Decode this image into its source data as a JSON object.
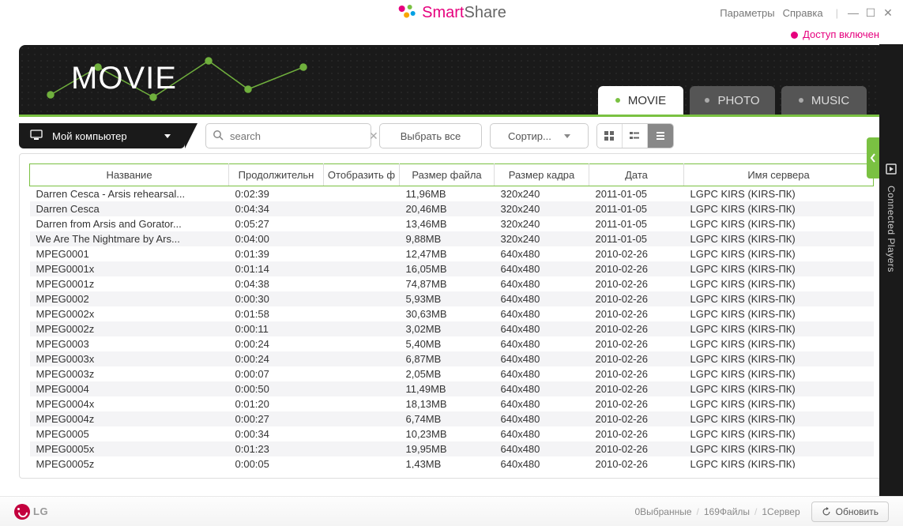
{
  "brand": {
    "smart": "Smart",
    "share": "Share"
  },
  "topmenu": {
    "params": "Параметры",
    "help": "Справка"
  },
  "access": {
    "label": "Доступ включен"
  },
  "header": {
    "title": "MOVIE"
  },
  "tabs": {
    "movie": "MOVIE",
    "photo": "PHOTO",
    "music": "MUSIC"
  },
  "source": {
    "label": "Мой компьютер"
  },
  "search": {
    "placeholder": "search"
  },
  "toolbar": {
    "select_all": "Выбрать все",
    "sort": "Сортир..."
  },
  "columns": {
    "name": "Название",
    "duration": "Продолжительн",
    "display": "Отобразить ф",
    "filesize": "Размер файла",
    "framesize": "Размер кадра",
    "date": "Дата",
    "server": "Имя сервера"
  },
  "rows": [
    {
      "name": "Darren Cesca - Arsis rehearsal...",
      "duration": "0:02:39",
      "display": "",
      "filesize": "11,96MB",
      "framesize": "320x240",
      "date": "2011-01-05",
      "server": "LGPC KIRS (KIRS-ПК)"
    },
    {
      "name": "Darren Cesca",
      "duration": "0:04:34",
      "display": "",
      "filesize": "20,46MB",
      "framesize": "320x240",
      "date": "2011-01-05",
      "server": "LGPC KIRS (KIRS-ПК)"
    },
    {
      "name": "Darren from Arsis and Gorator...",
      "duration": "0:05:27",
      "display": "",
      "filesize": "13,46MB",
      "framesize": "320x240",
      "date": "2011-01-05",
      "server": "LGPC KIRS (KIRS-ПК)"
    },
    {
      "name": "We Are The Nightmare by Ars...",
      "duration": "0:04:00",
      "display": "",
      "filesize": "9,88MB",
      "framesize": "320x240",
      "date": "2011-01-05",
      "server": "LGPC KIRS (KIRS-ПК)"
    },
    {
      "name": "MPEG0001",
      "duration": "0:01:39",
      "display": "",
      "filesize": "12,47MB",
      "framesize": "640x480",
      "date": "2010-02-26",
      "server": "LGPC KIRS (KIRS-ПК)"
    },
    {
      "name": "MPEG0001x",
      "duration": "0:01:14",
      "display": "",
      "filesize": "16,05MB",
      "framesize": "640x480",
      "date": "2010-02-26",
      "server": "LGPC KIRS (KIRS-ПК)"
    },
    {
      "name": "MPEG0001z",
      "duration": "0:04:38",
      "display": "",
      "filesize": "74,87MB",
      "framesize": "640x480",
      "date": "2010-02-26",
      "server": "LGPC KIRS (KIRS-ПК)"
    },
    {
      "name": "MPEG0002",
      "duration": "0:00:30",
      "display": "",
      "filesize": "5,93MB",
      "framesize": "640x480",
      "date": "2010-02-26",
      "server": "LGPC KIRS (KIRS-ПК)"
    },
    {
      "name": "MPEG0002x",
      "duration": "0:01:58",
      "display": "",
      "filesize": "30,63MB",
      "framesize": "640x480",
      "date": "2010-02-26",
      "server": "LGPC KIRS (KIRS-ПК)"
    },
    {
      "name": "MPEG0002z",
      "duration": "0:00:11",
      "display": "",
      "filesize": "3,02MB",
      "framesize": "640x480",
      "date": "2010-02-26",
      "server": "LGPC KIRS (KIRS-ПК)"
    },
    {
      "name": "MPEG0003",
      "duration": "0:00:24",
      "display": "",
      "filesize": "5,40MB",
      "framesize": "640x480",
      "date": "2010-02-26",
      "server": "LGPC KIRS (KIRS-ПК)"
    },
    {
      "name": "MPEG0003x",
      "duration": "0:00:24",
      "display": "",
      "filesize": "6,87MB",
      "framesize": "640x480",
      "date": "2010-02-26",
      "server": "LGPC KIRS (KIRS-ПК)"
    },
    {
      "name": "MPEG0003z",
      "duration": "0:00:07",
      "display": "",
      "filesize": "2,05MB",
      "framesize": "640x480",
      "date": "2010-02-26",
      "server": "LGPC KIRS (KIRS-ПК)"
    },
    {
      "name": "MPEG0004",
      "duration": "0:00:50",
      "display": "",
      "filesize": "11,49MB",
      "framesize": "640x480",
      "date": "2010-02-26",
      "server": "LGPC KIRS (KIRS-ПК)"
    },
    {
      "name": "MPEG0004x",
      "duration": "0:01:20",
      "display": "",
      "filesize": "18,13MB",
      "framesize": "640x480",
      "date": "2010-02-26",
      "server": "LGPC KIRS (KIRS-ПК)"
    },
    {
      "name": "MPEG0004z",
      "duration": "0:00:27",
      "display": "",
      "filesize": "6,74MB",
      "framesize": "640x480",
      "date": "2010-02-26",
      "server": "LGPC KIRS (KIRS-ПК)"
    },
    {
      "name": "MPEG0005",
      "duration": "0:00:34",
      "display": "",
      "filesize": "10,23MB",
      "framesize": "640x480",
      "date": "2010-02-26",
      "server": "LGPC KIRS (KIRS-ПК)"
    },
    {
      "name": "MPEG0005x",
      "duration": "0:01:23",
      "display": "",
      "filesize": "19,95MB",
      "framesize": "640x480",
      "date": "2010-02-26",
      "server": "LGPC KIRS (KIRS-ПК)"
    },
    {
      "name": "MPEG0005z",
      "duration": "0:00:05",
      "display": "",
      "filesize": "1,43MB",
      "framesize": "640x480",
      "date": "2010-02-26",
      "server": "LGPC KIRS (KIRS-ПК)"
    }
  ],
  "footer": {
    "selected": "0Выбранные",
    "files": "169Файлы",
    "servers": "1Сервер",
    "refresh": "Обновить"
  },
  "side": {
    "label": "Connected Players"
  }
}
